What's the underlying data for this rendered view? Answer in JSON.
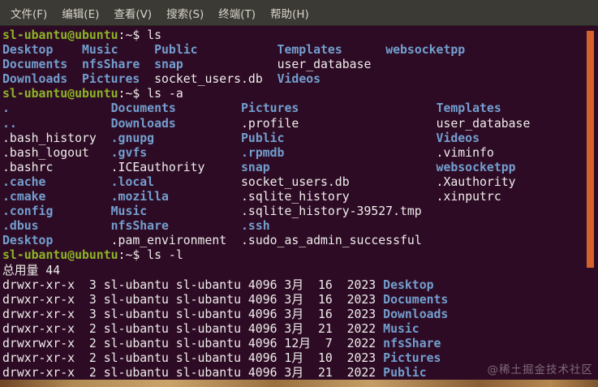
{
  "menu_bar": {
    "items": [
      {
        "label": "文件(F)"
      },
      {
        "label": "编辑(E)"
      },
      {
        "label": "查看(V)"
      },
      {
        "label": "搜索(S)"
      },
      {
        "label": "终端(T)"
      },
      {
        "label": "帮助(H)"
      }
    ]
  },
  "colors": {
    "terminal_bg": "#2e0b24",
    "menubar_bg": "#3b3a35",
    "prompt_green": "#8cb525",
    "directory_blue": "#729fcf",
    "text_white": "#eeeeec",
    "scrollbar_orange": "#d4622c",
    "wallpaper_tan": "#caa36b"
  },
  "watermark": {
    "text": "@稀土掘金技术社区"
  },
  "terminal": {
    "prompt": "sl-ubantu@ubuntu:~$",
    "lines": [
      {
        "segs": [
          {
            "sp": 0,
            "t": "sl-ubantu@ubuntu",
            "s": "prompt"
          },
          {
            "sp": 0,
            "t": ":~$",
            "s": "plain"
          },
          {
            "sp": 1,
            "t": "ls",
            "s": "plain"
          }
        ]
      },
      {
        "segs": [
          {
            "sp": 0,
            "t": "Desktop",
            "s": "dir"
          },
          {
            "sp": 4,
            "t": "Music",
            "s": "dir"
          },
          {
            "sp": 5,
            "t": "Public",
            "s": "dir"
          },
          {
            "sp": 11,
            "t": "Templates",
            "s": "dir"
          },
          {
            "sp": 6,
            "t": "websocketpp",
            "s": "dir"
          }
        ]
      },
      {
        "segs": [
          {
            "sp": 0,
            "t": "Documents",
            "s": "dir"
          },
          {
            "sp": 2,
            "t": "nfsShare",
            "s": "dir"
          },
          {
            "sp": 2,
            "t": "snap",
            "s": "dir"
          },
          {
            "sp": 13,
            "t": "user_database",
            "s": "plain"
          }
        ]
      },
      {
        "segs": [
          {
            "sp": 0,
            "t": "Downloads",
            "s": "dir"
          },
          {
            "sp": 2,
            "t": "Pictures",
            "s": "dir"
          },
          {
            "sp": 2,
            "t": "socket_users.db",
            "s": "plain"
          },
          {
            "sp": 2,
            "t": "Videos",
            "s": "dir"
          }
        ]
      },
      {
        "segs": [
          {
            "sp": 0,
            "t": "sl-ubantu@ubuntu",
            "s": "prompt"
          },
          {
            "sp": 0,
            "t": ":~$",
            "s": "plain"
          },
          {
            "sp": 1,
            "t": "ls -a",
            "s": "plain"
          }
        ]
      },
      {
        "segs": [
          {
            "sp": 0,
            "t": ".",
            "s": "dir"
          },
          {
            "sp": 14,
            "t": "Documents",
            "s": "dir"
          },
          {
            "sp": 9,
            "t": "Pictures",
            "s": "dir"
          },
          {
            "sp": 19,
            "t": "Templates",
            "s": "dir"
          }
        ]
      },
      {
        "segs": [
          {
            "sp": 0,
            "t": "..",
            "s": "dir"
          },
          {
            "sp": 13,
            "t": "Downloads",
            "s": "dir"
          },
          {
            "sp": 9,
            "t": ".profile",
            "s": "plain"
          },
          {
            "sp": 19,
            "t": "user_database",
            "s": "plain"
          }
        ]
      },
      {
        "segs": [
          {
            "sp": 0,
            "t": ".bash_history",
            "s": "plain"
          },
          {
            "sp": 2,
            "t": ".gnupg",
            "s": "dir"
          },
          {
            "sp": 12,
            "t": "Public",
            "s": "dir"
          },
          {
            "sp": 21,
            "t": "Videos",
            "s": "dir"
          }
        ]
      },
      {
        "segs": [
          {
            "sp": 0,
            "t": ".bash_logout",
            "s": "plain"
          },
          {
            "sp": 3,
            "t": ".gvfs",
            "s": "dir"
          },
          {
            "sp": 13,
            "t": ".rpmdb",
            "s": "dir"
          },
          {
            "sp": 21,
            "t": ".viminfo",
            "s": "plain"
          }
        ]
      },
      {
        "segs": [
          {
            "sp": 0,
            "t": ".bashrc",
            "s": "plain"
          },
          {
            "sp": 8,
            "t": ".ICEauthority",
            "s": "plain"
          },
          {
            "sp": 5,
            "t": "snap",
            "s": "dir"
          },
          {
            "sp": 23,
            "t": "websocketpp",
            "s": "dir"
          }
        ]
      },
      {
        "segs": [
          {
            "sp": 0,
            "t": ".cache",
            "s": "dir"
          },
          {
            "sp": 9,
            "t": ".local",
            "s": "dir"
          },
          {
            "sp": 12,
            "t": "socket_users.db",
            "s": "plain"
          },
          {
            "sp": 12,
            "t": ".Xauthority",
            "s": "plain"
          }
        ]
      },
      {
        "segs": [
          {
            "sp": 0,
            "t": ".cmake",
            "s": "dir"
          },
          {
            "sp": 9,
            "t": ".mozilla",
            "s": "dir"
          },
          {
            "sp": 10,
            "t": ".sqlite_history",
            "s": "plain"
          },
          {
            "sp": 12,
            "t": ".xinputrc",
            "s": "plain"
          }
        ]
      },
      {
        "segs": [
          {
            "sp": 0,
            "t": ".config",
            "s": "dir"
          },
          {
            "sp": 8,
            "t": "Music",
            "s": "dir"
          },
          {
            "sp": 13,
            "t": ".sqlite_history-39527.tmp",
            "s": "plain"
          }
        ]
      },
      {
        "segs": [
          {
            "sp": 0,
            "t": ".dbus",
            "s": "dir"
          },
          {
            "sp": 10,
            "t": "nfsShare",
            "s": "dir"
          },
          {
            "sp": 10,
            "t": ".ssh",
            "s": "dir"
          }
        ]
      },
      {
        "segs": [
          {
            "sp": 0,
            "t": "Desktop",
            "s": "dir"
          },
          {
            "sp": 8,
            "t": ".pam_environment",
            "s": "plain"
          },
          {
            "sp": 2,
            "t": ".sudo_as_admin_successful",
            "s": "plain"
          }
        ]
      },
      {
        "segs": [
          {
            "sp": 0,
            "t": "sl-ubantu@ubuntu",
            "s": "prompt"
          },
          {
            "sp": 0,
            "t": ":~$",
            "s": "plain"
          },
          {
            "sp": 1,
            "t": "ls -l",
            "s": "plain"
          }
        ]
      },
      {
        "segs": [
          {
            "sp": 0,
            "t": "总用量 44",
            "s": "plain"
          }
        ]
      },
      {
        "segs": [
          {
            "sp": 0,
            "t": "drwxr-xr-x  3 sl-ubantu sl-ubantu 4096 3月  16  2023",
            "s": "plain"
          },
          {
            "sp": 1,
            "t": "Desktop",
            "s": "dir"
          }
        ]
      },
      {
        "segs": [
          {
            "sp": 0,
            "t": "drwxr-xr-x  3 sl-ubantu sl-ubantu 4096 3月  16  2023",
            "s": "plain"
          },
          {
            "sp": 1,
            "t": "Documents",
            "s": "dir"
          }
        ]
      },
      {
        "segs": [
          {
            "sp": 0,
            "t": "drwxr-xr-x  3 sl-ubantu sl-ubantu 4096 3月  16  2023",
            "s": "plain"
          },
          {
            "sp": 1,
            "t": "Downloads",
            "s": "dir"
          }
        ]
      },
      {
        "segs": [
          {
            "sp": 0,
            "t": "drwxr-xr-x  2 sl-ubantu sl-ubantu 4096 3月  21  2022",
            "s": "plain"
          },
          {
            "sp": 1,
            "t": "Music",
            "s": "dir"
          }
        ]
      },
      {
        "segs": [
          {
            "sp": 0,
            "t": "drwxrwxr-x  2 sl-ubantu sl-ubantu 4096 12月  7  2022",
            "s": "plain"
          },
          {
            "sp": 1,
            "t": "nfsShare",
            "s": "dir"
          }
        ]
      },
      {
        "segs": [
          {
            "sp": 0,
            "t": "drwxr-xr-x  2 sl-ubantu sl-ubantu 4096 1月  10  2023",
            "s": "plain"
          },
          {
            "sp": 1,
            "t": "Pictures",
            "s": "dir"
          }
        ]
      },
      {
        "segs": [
          {
            "sp": 0,
            "t": "drwxr-xr-x  2 sl-ubantu sl-ubantu 4096 3月  21  2022",
            "s": "plain"
          },
          {
            "sp": 1,
            "t": "Public",
            "s": "dir"
          }
        ]
      }
    ]
  }
}
